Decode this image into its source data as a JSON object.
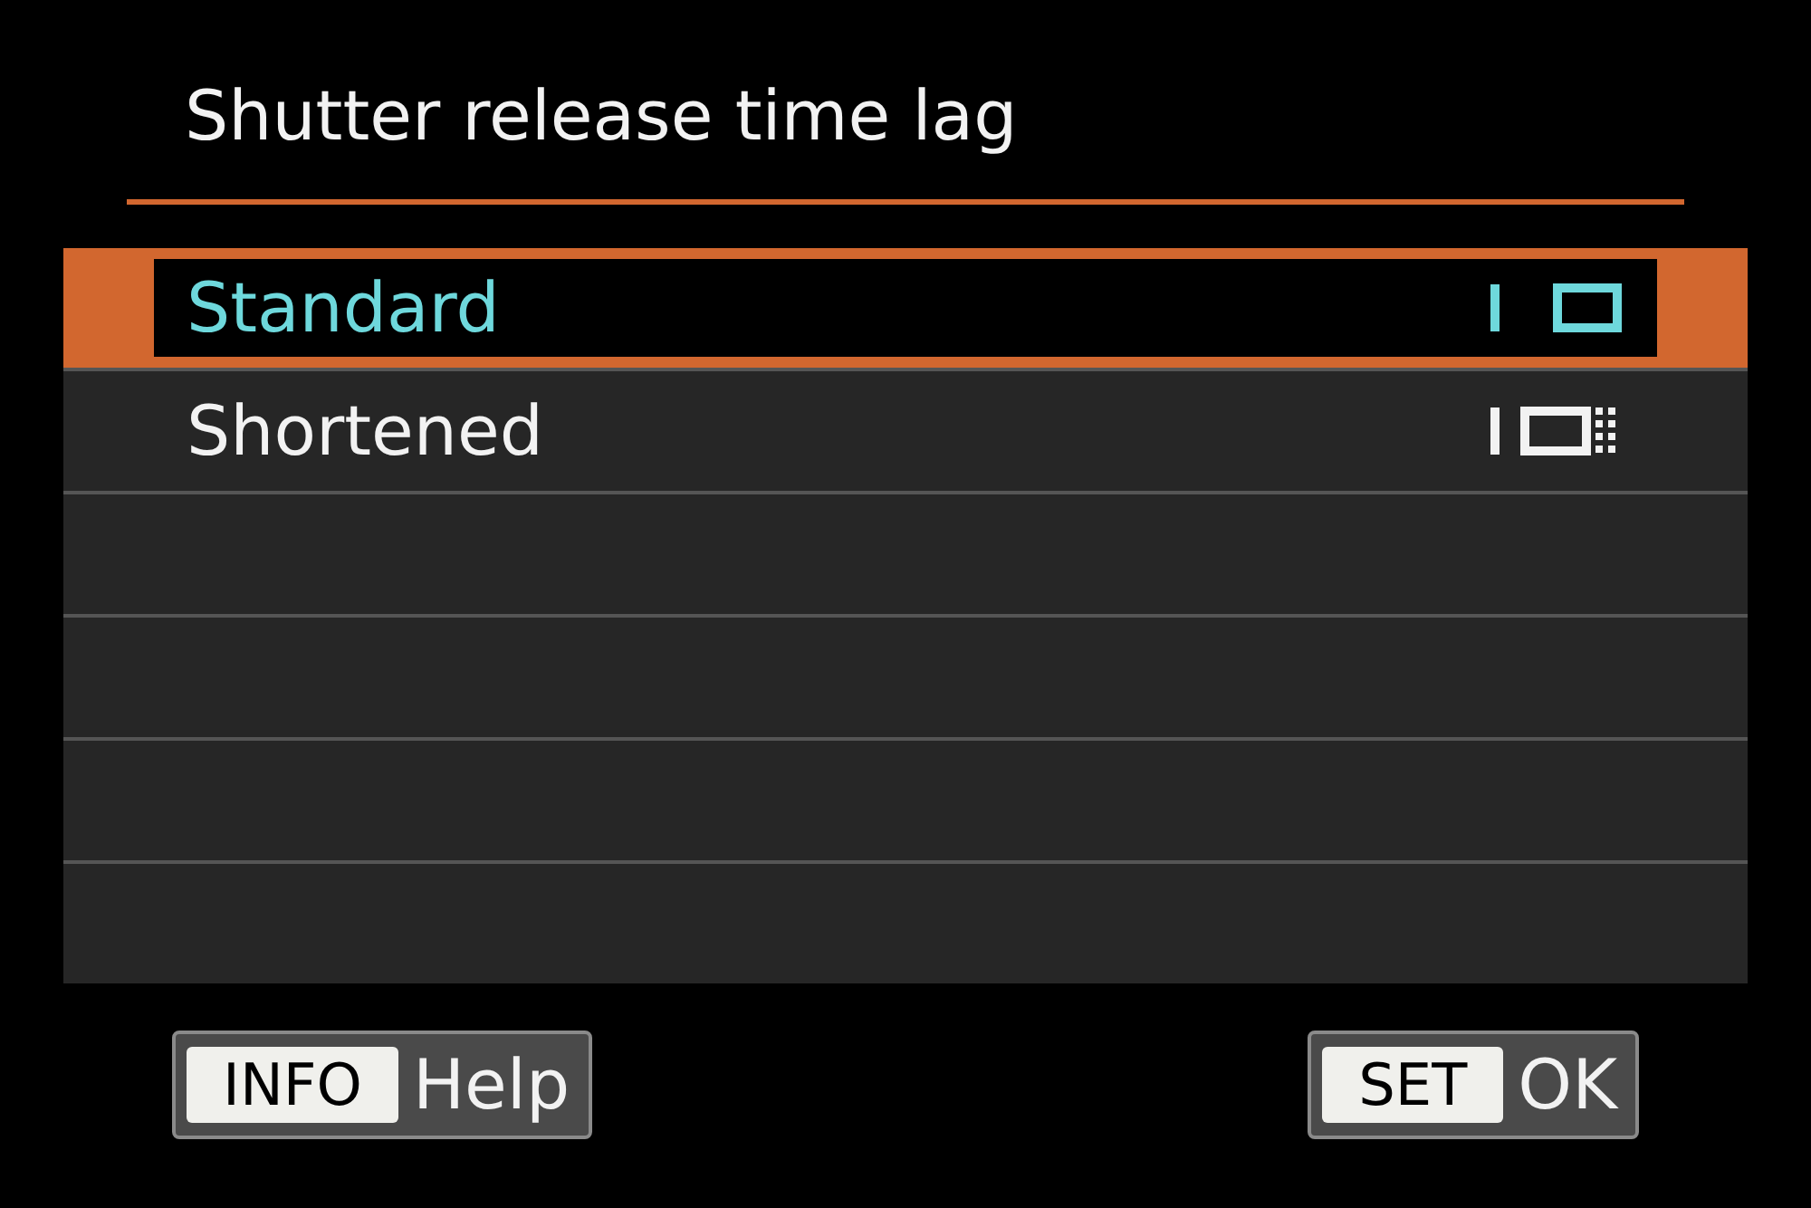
{
  "title": "Shutter release time lag",
  "options": [
    {
      "label": "Standard",
      "selected": true,
      "kind": "plain"
    },
    {
      "label": "Shortened",
      "selected": false,
      "kind": "dotted"
    }
  ],
  "footer": [
    {
      "key": "INFO",
      "label": "Help"
    },
    {
      "key": "SET",
      "label": "OK"
    }
  ]
}
